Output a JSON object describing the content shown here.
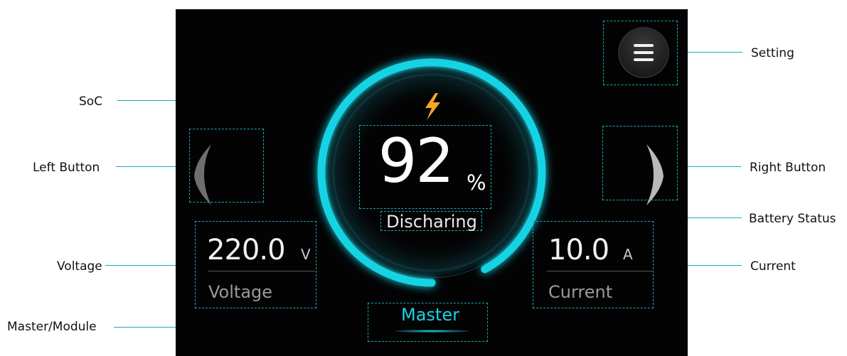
{
  "callouts": {
    "soc": "SoC",
    "left_button": "Left Button",
    "voltage": "Voltage",
    "master_module": "Master/Module",
    "setting": "Setting",
    "right_button": "Right Button",
    "battery_status": "Battery Status",
    "current": "Current"
  },
  "screen": {
    "soc": {
      "value": "92",
      "unit": "%",
      "fraction": 0.92
    },
    "battery_status": "Discharing",
    "voltage": {
      "value": "220.0",
      "unit": "V",
      "label": "Voltage"
    },
    "current": {
      "value": "10.0",
      "unit": "A",
      "label": "Current"
    },
    "mode": "Master"
  },
  "icons": {
    "status": "lightning-bolt-icon",
    "setting": "hamburger-menu-icon",
    "left": "chevron-left-icon",
    "right": "chevron-right-icon"
  },
  "colors": {
    "accent": "#19d3e3",
    "bolt": "#f6a623",
    "callout_line": "#1ba9b5",
    "screen_bg": "#030304"
  }
}
